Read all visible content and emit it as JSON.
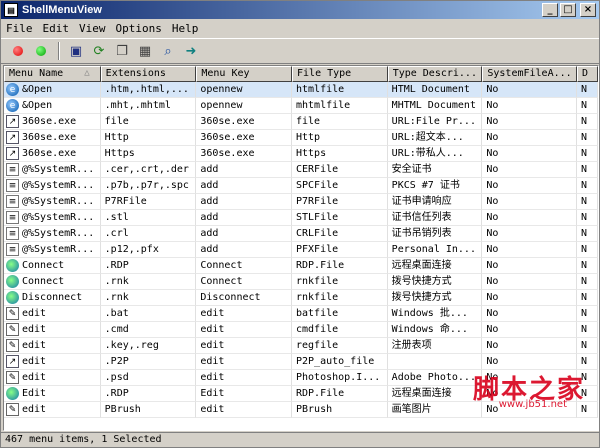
{
  "window": {
    "title": "ShellMenuView",
    "minimize": "_",
    "maximize": "□",
    "close": "×"
  },
  "menubar": [
    "File",
    "Edit",
    "View",
    "Options",
    "Help"
  ],
  "toolbar": {
    "colors": {
      "red": "#e00000",
      "green": "#00c000"
    }
  },
  "columns": [
    "Menu Name",
    "Extensions",
    "Menu Key",
    "File Type",
    "Type Descri...",
    "SystemFileA...",
    "D"
  ],
  "sort_indicator": "△",
  "rows": [
    {
      "icon": "ie-icon",
      "name": "&Open",
      "ext": ".htm,.html,...",
      "key": "opennew",
      "type": "htmlfile",
      "desc": "HTML Document",
      "sys": "No",
      "d": "N",
      "selected": true
    },
    {
      "icon": "ie-icon",
      "name": "&Open",
      "ext": ".mht,.mhtml",
      "key": "opennew",
      "type": "mhtmlfile",
      "desc": "MHTML Document",
      "sys": "No",
      "d": "N",
      "selected": false
    },
    {
      "icon": "link-icon",
      "name": "360se.exe",
      "ext": "file",
      "key": "360se.exe",
      "type": "file",
      "desc": "URL:File Pr...",
      "sys": "No",
      "d": "N",
      "selected": false
    },
    {
      "icon": "link-icon",
      "name": "360se.exe",
      "ext": "Http",
      "key": "360se.exe",
      "type": "Http",
      "desc": "URL:超文本...",
      "sys": "No",
      "d": "N",
      "selected": false
    },
    {
      "icon": "link-icon",
      "name": "360se.exe",
      "ext": "Https",
      "key": "360se.exe",
      "type": "Https",
      "desc": "URL:带私人...",
      "sys": "No",
      "d": "N",
      "selected": false
    },
    {
      "icon": "doc-icon",
      "name": "@%SystemR...",
      "ext": ".cer,.crt,.der",
      "key": "add",
      "type": "CERFile",
      "desc": "安全证书",
      "sys": "No",
      "d": "N",
      "selected": false
    },
    {
      "icon": "doc-icon",
      "name": "@%SystemR...",
      "ext": ".p7b,.p7r,.spc",
      "key": "add",
      "type": "SPCFile",
      "desc": "PKCS #7 证书",
      "sys": "No",
      "d": "N",
      "selected": false
    },
    {
      "icon": "doc-icon",
      "name": "@%SystemR...",
      "ext": "P7RFile",
      "key": "add",
      "type": "P7RFile",
      "desc": "证书申请响应",
      "sys": "No",
      "d": "N",
      "selected": false
    },
    {
      "icon": "doc-icon",
      "name": "@%SystemR...",
      "ext": ".stl",
      "key": "add",
      "type": "STLFile",
      "desc": "证书信任列表",
      "sys": "No",
      "d": "N",
      "selected": false
    },
    {
      "icon": "doc-icon",
      "name": "@%SystemR...",
      "ext": ".crl",
      "key": "add",
      "type": "CRLFile",
      "desc": "证书吊销列表",
      "sys": "No",
      "d": "N",
      "selected": false
    },
    {
      "icon": "doc-icon",
      "name": "@%SystemR...",
      "ext": ".p12,.pfx",
      "key": "add",
      "type": "PFXFile",
      "desc": "Personal In...",
      "sys": "No",
      "d": "N",
      "selected": false
    },
    {
      "icon": "globe-icon",
      "name": "Connect",
      "ext": ".RDP",
      "key": "Connect",
      "type": "RDP.File",
      "desc": "远程桌面连接",
      "sys": "No",
      "d": "N",
      "selected": false
    },
    {
      "icon": "globe-icon",
      "name": "Connect",
      "ext": ".rnk",
      "key": "Connect",
      "type": "rnkfile",
      "desc": "拨号快捷方式",
      "sys": "No",
      "d": "N",
      "selected": false
    },
    {
      "icon": "globe-icon",
      "name": "Disconnect",
      "ext": ".rnk",
      "key": "Disconnect",
      "type": "rnkfile",
      "desc": "拨号快捷方式",
      "sys": "No",
      "d": "N",
      "selected": false
    },
    {
      "icon": "tool-icon",
      "name": "edit",
      "ext": ".bat",
      "key": "edit",
      "type": "batfile",
      "desc": "Windows 批...",
      "sys": "No",
      "d": "N",
      "selected": false
    },
    {
      "icon": "tool-icon",
      "name": "edit",
      "ext": ".cmd",
      "key": "edit",
      "type": "cmdfile",
      "desc": "Windows 命...",
      "sys": "No",
      "d": "N",
      "selected": false
    },
    {
      "icon": "tool-icon",
      "name": "edit",
      "ext": ".key,.reg",
      "key": "edit",
      "type": "regfile",
      "desc": "注册表项",
      "sys": "No",
      "d": "N",
      "selected": false
    },
    {
      "icon": "link-icon",
      "name": "edit",
      "ext": ".P2P",
      "key": "edit",
      "type": "P2P_auto_file",
      "desc": "",
      "sys": "No",
      "d": "N",
      "selected": false
    },
    {
      "icon": "tool-icon",
      "name": "edit",
      "ext": ".psd",
      "key": "edit",
      "type": "Photoshop.I...",
      "desc": "Adobe Photo...",
      "sys": "No",
      "d": "N",
      "selected": false
    },
    {
      "icon": "globe-icon",
      "name": "Edit",
      "ext": ".RDP",
      "key": "Edit",
      "type": "RDP.File",
      "desc": "远程桌面连接",
      "sys": "No",
      "d": "N",
      "selected": false
    },
    {
      "icon": "tool-icon",
      "name": "edit",
      "ext": "PBrush",
      "key": "edit",
      "type": "PBrush",
      "desc": "画笔图片",
      "sys": "No",
      "d": "N",
      "selected": false
    }
  ],
  "status": "467 menu items, 1 Selected",
  "watermark": {
    "main": "脚本之家",
    "sub": "www.jb51.net"
  }
}
